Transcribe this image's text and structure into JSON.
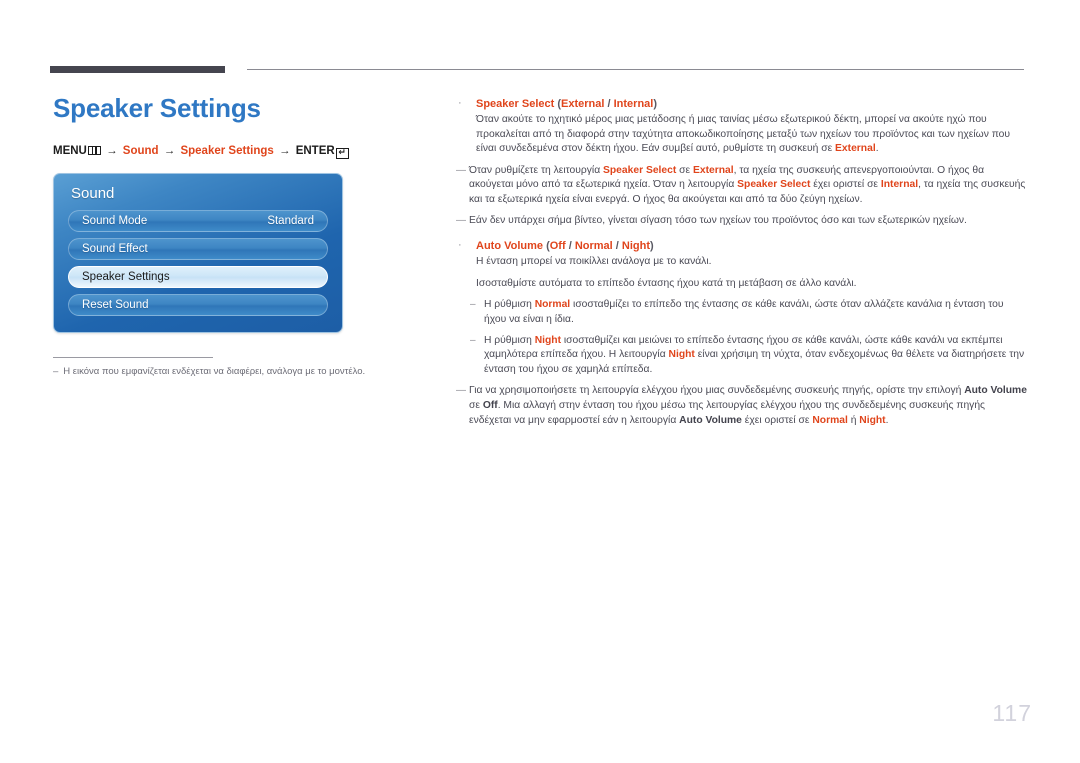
{
  "document": {
    "page_number": "117",
    "title": "Speaker Settings",
    "accent_color": "#e0451c",
    "title_color": "#2f78c4"
  },
  "breadcrumb": {
    "menu_label": "MENU",
    "menu_icon": "menu-bars-icon",
    "arrow1": "→",
    "item1": "Sound",
    "arrow2": "→",
    "item2": "Speaker Settings",
    "arrow3": "→",
    "enter_label": "ENTER",
    "enter_icon": "enter-return-icon",
    "enter_glyph": "↵"
  },
  "osd": {
    "heading": "Sound",
    "rows": [
      {
        "label": "Sound Mode",
        "value": "Standard",
        "selected": false
      },
      {
        "label": "Sound Effect",
        "value": "",
        "selected": false
      },
      {
        "label": "Speaker Settings",
        "value": "",
        "selected": true
      },
      {
        "label": "Reset Sound",
        "value": "",
        "selected": false
      }
    ]
  },
  "footnote": {
    "dash": "‒",
    "text": "Η εικόνα που εμφανίζεται ενδέχεται να διαφέρει, ανάλογα με το μοντέλο."
  },
  "content": {
    "bullet_dot": "·",
    "long_dash": "—",
    "en_dash": "–",
    "sections": [
      {
        "title_main": "Speaker Select",
        "title_rest": " (External / Internal)",
        "paragraphs": [
          "Όταν ακούτε το ηχητικό μέρος μιας μετάδοσης ή μιας ταινίας μέσω εξωτερικού δέκτη, μπορεί να ακούτε ηχώ που προκαλείται από τη διαφορά στην ταχύτητα αποκωδικοποίησης μεταξύ των ηχείων του προϊόντος και των ηχείων που είναι συνδεδεμένα στον δέκτη ήχου. Εάν συμβεί αυτό, ρυθμίστε τη συσκευή σε External."
        ],
        "sub_items": [
          "Όταν ρυθμίζετε τη λειτουργία Speaker Select σε External, τα ηχεία της συσκευής απενεργοποιούνται. Ο ήχος θα ακούγεται μόνο από τα εξωτερικά ηχεία. Όταν η λειτουργία Speaker Select έχει οριστεί σε Internal, τα ηχεία της συσκευής και τα εξωτερικά ηχεία είναι ενεργά. Ο ήχος θα ακούγεται και από τα δύο ζεύγη ηχείων.",
          "Εάν δεν υπάρχει σήμα βίντεο, γίνεται σίγαση τόσο των ηχείων του προϊόντος όσο και των εξωτερικών ηχείων."
        ]
      },
      {
        "title_main": "Auto Volume",
        "title_rest": " (Off / Normal / Night)",
        "paragraphs": [
          "Η ένταση μπορεί να ποικίλλει ανάλογα με το κανάλι.",
          "Ισοσταθμίστε αυτόματα το επίπεδο έντασης ήχου κατά τη μετάβαση σε άλλο κανάλι."
        ],
        "sub_items_level2": [
          "Η ρύθμιση Normal ισοσταθμίζει το επίπεδο της έντασης σε κάθε κανάλι, ώστε όταν αλλάζετε κανάλια η ένταση του ήχου να είναι η ίδια.",
          "Η ρύθμιση Night ισοσταθμίζει και μειώνει το επίπεδο έντασης ήχου σε κάθε κανάλι, ώστε κάθε κανάλι να εκπέμπει χαμηλότερα επίπεδα ήχου. Η λειτουργία Night είναι χρήσιμη τη νύχτα, όταν ενδεχομένως θα θέλετε να διατηρήσετε την ένταση του ήχου σε χαμηλά επίπεδα."
        ],
        "sub_items": [
          "Για να χρησιμοποιήσετε τη λειτουργία ελέγχου ήχου μιας συνδεδεμένης συσκευής πηγής, ορίστε την επιλογή Auto Volume σε Off. Μια αλλαγή στην ένταση του ήχου μέσω της λειτουργίας ελέγχου ήχου της συνδεδεμένης συσκευής πηγής ενδέχεται να μην εφαρμοστεί εάν η λειτουργία Auto Volume έχει οριστεί σε Normal ή Night."
        ]
      }
    ]
  }
}
